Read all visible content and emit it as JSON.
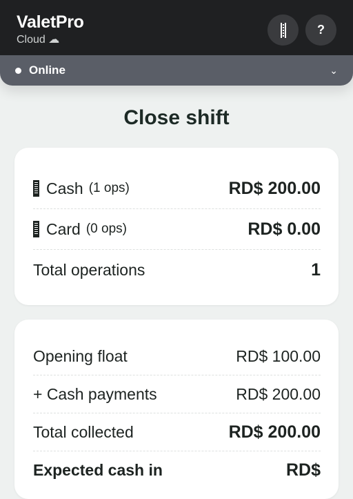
{
  "header": {
    "app_name": "ValetPro",
    "subtitle": "Cloud ☁",
    "scan_icon": "barcode-scan-icon",
    "help_label": "?"
  },
  "status": {
    "label": "Online",
    "chevron": "⌄"
  },
  "page": {
    "title": "Close shift"
  },
  "summary": {
    "rows": [
      {
        "icon": "barcode-icon",
        "label": "Cash",
        "ops": "(1 ops)",
        "value": "RD$ 200.00"
      },
      {
        "icon": "barcode-icon",
        "label": "Card",
        "ops": "(0 ops)",
        "value": "RD$ 0.00"
      },
      {
        "label": "Total operations",
        "value": "1"
      }
    ]
  },
  "reconciliation": {
    "rows": [
      {
        "label": "Opening float",
        "value": "RD$ 100.00"
      },
      {
        "label": "+ Cash payments",
        "value": "RD$ 200.00"
      },
      {
        "label": "Total collected",
        "value": "RD$ 200.00"
      },
      {
        "label": "Expected cash in",
        "value": "RD$"
      }
    ]
  }
}
